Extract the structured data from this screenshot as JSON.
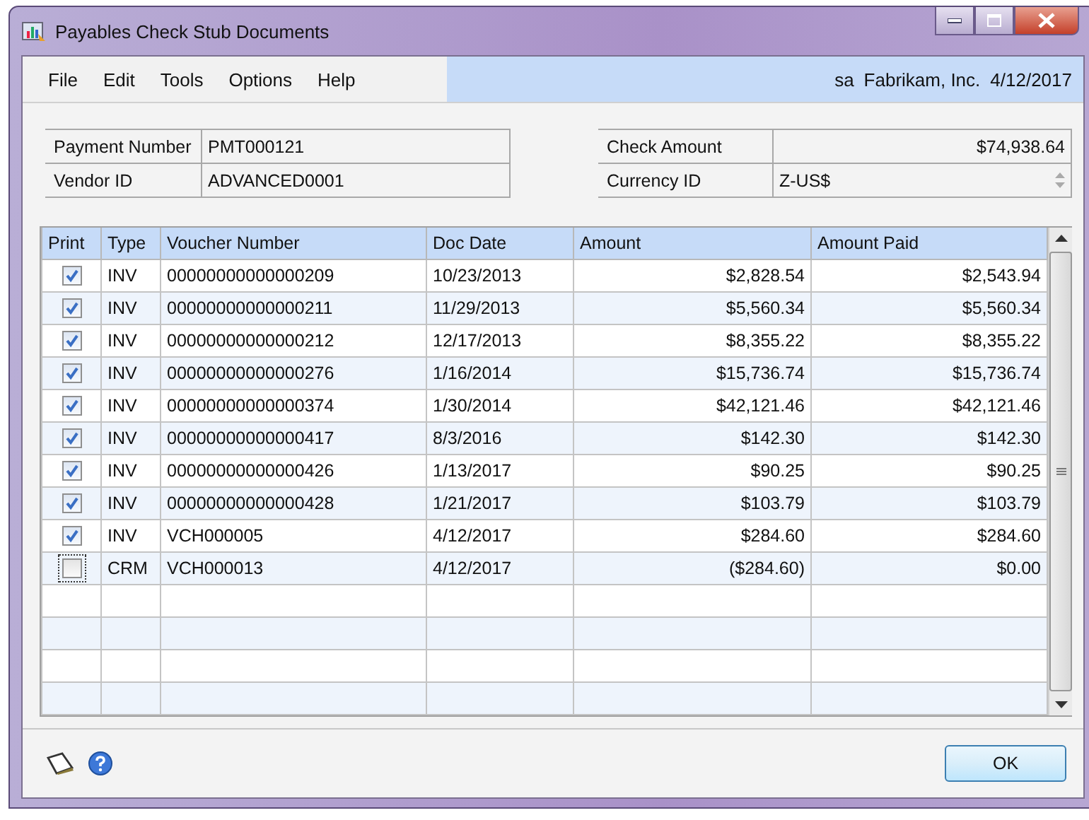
{
  "window": {
    "title": "Payables Check Stub Documents"
  },
  "menu": [
    "File",
    "Edit",
    "Tools",
    "Options",
    "Help"
  ],
  "session": {
    "user": "sa",
    "company": "Fabrikam, Inc.",
    "date": "4/12/2017"
  },
  "fields_left": [
    {
      "label": "Payment Number",
      "value": "PMT000121"
    },
    {
      "label": "Vendor ID",
      "value": "ADVANCED0001"
    }
  ],
  "fields_right": [
    {
      "label": "Check Amount",
      "value": "$74,938.64",
      "kind": "amount"
    },
    {
      "label": "Currency ID",
      "value": "Z-US$",
      "kind": "lookup"
    }
  ],
  "table": {
    "columns": [
      "Print",
      "Type",
      "Voucher Number",
      "Doc Date",
      "Amount",
      "Amount Paid"
    ],
    "rows": [
      {
        "checked": true,
        "type": "INV",
        "voucher": "00000000000000209",
        "date": "10/23/2013",
        "amount": "$2,828.54",
        "paid": "$2,543.94"
      },
      {
        "checked": true,
        "type": "INV",
        "voucher": "00000000000000211",
        "date": "11/29/2013",
        "amount": "$5,560.34",
        "paid": "$5,560.34"
      },
      {
        "checked": true,
        "type": "INV",
        "voucher": "00000000000000212",
        "date": "12/17/2013",
        "amount": "$8,355.22",
        "paid": "$8,355.22"
      },
      {
        "checked": true,
        "type": "INV",
        "voucher": "00000000000000276",
        "date": "1/16/2014",
        "amount": "$15,736.74",
        "paid": "$15,736.74"
      },
      {
        "checked": true,
        "type": "INV",
        "voucher": "00000000000000374",
        "date": "1/30/2014",
        "amount": "$42,121.46",
        "paid": "$42,121.46"
      },
      {
        "checked": true,
        "type": "INV",
        "voucher": "00000000000000417",
        "date": "8/3/2016",
        "amount": "$142.30",
        "paid": "$142.30"
      },
      {
        "checked": true,
        "type": "INV",
        "voucher": "00000000000000426",
        "date": "1/13/2017",
        "amount": "$90.25",
        "paid": "$90.25"
      },
      {
        "checked": true,
        "type": "INV",
        "voucher": "00000000000000428",
        "date": "1/21/2017",
        "amount": "$103.79",
        "paid": "$103.79"
      },
      {
        "checked": true,
        "type": "INV",
        "voucher": "VCH000005",
        "date": "4/12/2017",
        "amount": "$284.60",
        "paid": "$284.60"
      },
      {
        "checked": false,
        "type": "CRM",
        "voucher": "VCH000013",
        "date": "4/12/2017",
        "amount": "($284.60)",
        "paid": "$0.00"
      }
    ]
  },
  "buttons": [
    "OK"
  ]
}
